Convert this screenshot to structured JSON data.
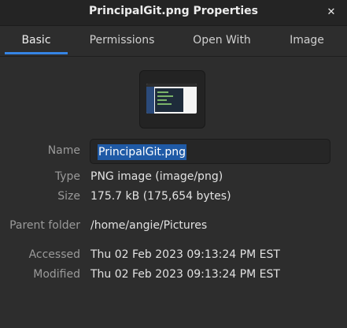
{
  "window": {
    "title": "PrincipalGit.png Properties",
    "close_glyph": "✕"
  },
  "tabs": [
    {
      "label": "Basic",
      "active": true
    },
    {
      "label": "Permissions",
      "active": false
    },
    {
      "label": "Open With",
      "active": false
    },
    {
      "label": "Image",
      "active": false
    }
  ],
  "thumbnail": {
    "icon": "image-thumbnail-icon"
  },
  "fields": {
    "name_label": "Name",
    "name_value": "PrincipalGit.png",
    "type_label": "Type",
    "type_value": "PNG image (image/png)",
    "size_label": "Size",
    "size_value": "175.7 kB (175,654 bytes)",
    "parent_label": "Parent folder",
    "parent_value": "/home/angie/Pictures",
    "accessed_label": "Accessed",
    "accessed_value": "Thu 02 Feb 2023 09:13:24 PM EST",
    "modified_label": "Modified",
    "modified_value": "Thu 02 Feb 2023 09:13:24 PM EST"
  },
  "colors": {
    "accent": "#3584e4",
    "selection": "#1f5aa6",
    "background": "#2d2d2d",
    "titlebar": "#242424"
  }
}
